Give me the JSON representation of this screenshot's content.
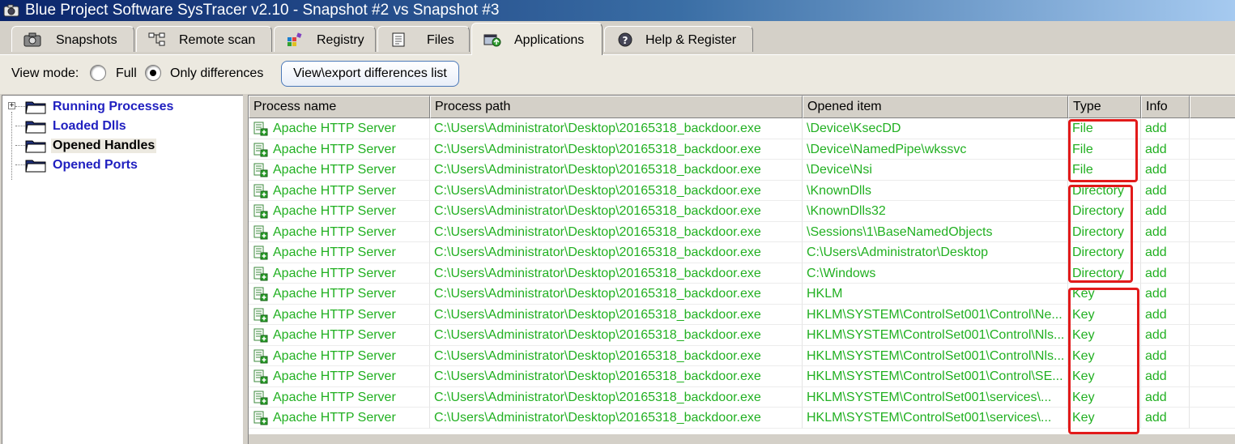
{
  "window": {
    "title": "Blue Project Software SysTracer v2.10 - Snapshot #2 vs Snapshot #3"
  },
  "tabs": [
    {
      "label": "Snapshots",
      "icon": "camera-icon"
    },
    {
      "label": "Remote scan",
      "icon": "network-icon"
    },
    {
      "label": "Registry",
      "icon": "registry-icon"
    },
    {
      "label": "Files",
      "icon": "files-icon"
    },
    {
      "label": "Applications",
      "icon": "applications-icon",
      "active": true
    },
    {
      "label": "Help & Register",
      "icon": "help-icon"
    }
  ],
  "toolbar": {
    "view_mode_label": "View mode:",
    "full_label": "Full",
    "only_differences_label": "Only differences",
    "selected_mode": "Only differences",
    "export_button_label": "View\\export differences list"
  },
  "tree": {
    "items": [
      {
        "label": "Running Processes",
        "expandable": true
      },
      {
        "label": "Loaded Dlls"
      },
      {
        "label": "Opened Handles",
        "selected": true
      },
      {
        "label": "Opened Ports"
      }
    ]
  },
  "grid": {
    "columns": [
      "Process name",
      "Process path",
      "Opened item",
      "Type",
      "Info"
    ],
    "rows": [
      [
        "Apache HTTP Server",
        "C:\\Users\\Administrator\\Desktop\\20165318_backdoor.exe",
        "\\Device\\KsecDD",
        "File",
        "add"
      ],
      [
        "Apache HTTP Server",
        "C:\\Users\\Administrator\\Desktop\\20165318_backdoor.exe",
        "\\Device\\NamedPipe\\wkssvc",
        "File",
        "add"
      ],
      [
        "Apache HTTP Server",
        "C:\\Users\\Administrator\\Desktop\\20165318_backdoor.exe",
        "\\Device\\Nsi",
        "File",
        "add"
      ],
      [
        "Apache HTTP Server",
        "C:\\Users\\Administrator\\Desktop\\20165318_backdoor.exe",
        "\\KnownDlls",
        "Directory",
        "add"
      ],
      [
        "Apache HTTP Server",
        "C:\\Users\\Administrator\\Desktop\\20165318_backdoor.exe",
        "\\KnownDlls32",
        "Directory",
        "add"
      ],
      [
        "Apache HTTP Server",
        "C:\\Users\\Administrator\\Desktop\\20165318_backdoor.exe",
        "\\Sessions\\1\\BaseNamedObjects",
        "Directory",
        "add"
      ],
      [
        "Apache HTTP Server",
        "C:\\Users\\Administrator\\Desktop\\20165318_backdoor.exe",
        "C:\\Users\\Administrator\\Desktop",
        "Directory",
        "add"
      ],
      [
        "Apache HTTP Server",
        "C:\\Users\\Administrator\\Desktop\\20165318_backdoor.exe",
        "C:\\Windows",
        "Directory",
        "add"
      ],
      [
        "Apache HTTP Server",
        "C:\\Users\\Administrator\\Desktop\\20165318_backdoor.exe",
        "HKLM",
        "Key",
        "add"
      ],
      [
        "Apache HTTP Server",
        "C:\\Users\\Administrator\\Desktop\\20165318_backdoor.exe",
        "HKLM\\SYSTEM\\ControlSet001\\Control\\Ne...",
        "Key",
        "add"
      ],
      [
        "Apache HTTP Server",
        "C:\\Users\\Administrator\\Desktop\\20165318_backdoor.exe",
        "HKLM\\SYSTEM\\ControlSet001\\Control\\Nls...",
        "Key",
        "add"
      ],
      [
        "Apache HTTP Server",
        "C:\\Users\\Administrator\\Desktop\\20165318_backdoor.exe",
        "HKLM\\SYSTEM\\ControlSet001\\Control\\Nls...",
        "Key",
        "add"
      ],
      [
        "Apache HTTP Server",
        "C:\\Users\\Administrator\\Desktop\\20165318_backdoor.exe",
        "HKLM\\SYSTEM\\ControlSet001\\Control\\SE...",
        "Key",
        "add"
      ],
      [
        "Apache HTTP Server",
        "C:\\Users\\Administrator\\Desktop\\20165318_backdoor.exe",
        "HKLM\\SYSTEM\\ControlSet001\\services\\...",
        "Key",
        "add"
      ],
      [
        "Apache HTTP Server",
        "C:\\Users\\Administrator\\Desktop\\20165318_backdoor.exe",
        "HKLM\\SYSTEM\\ControlSet001\\services\\...",
        "Key",
        "add"
      ]
    ],
    "row_color": "#22b022",
    "highlight_color": "#e21a1a"
  }
}
